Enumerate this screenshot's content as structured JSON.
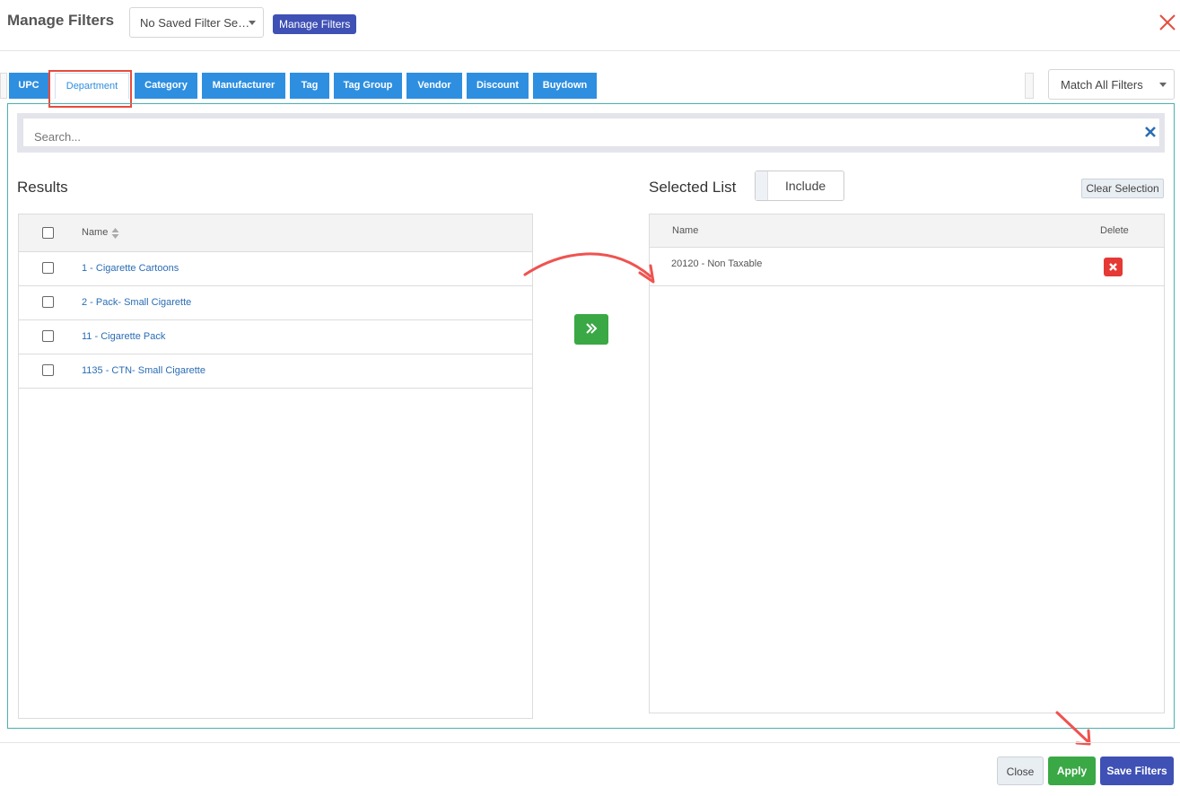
{
  "header": {
    "title": "Manage Filters",
    "saved_filter_value": "No Saved Filter Se…",
    "manage_button": "Manage Filters",
    "close_icon": "close-icon"
  },
  "tabs": [
    {
      "label": "UPC"
    },
    {
      "label": "Department"
    },
    {
      "label": "Category"
    },
    {
      "label": "Manufacturer"
    },
    {
      "label": "Tag"
    },
    {
      "label": "Tag Group"
    },
    {
      "label": "Vendor"
    },
    {
      "label": "Discount"
    },
    {
      "label": "Buydown"
    }
  ],
  "match_select": {
    "value": "Match All Filters"
  },
  "search": {
    "placeholder": "Search..."
  },
  "results": {
    "heading": "Results",
    "column_name": "Name",
    "rows": [
      {
        "label": "1 - Cigarette Cartoons"
      },
      {
        "label": "2 - Pack- Small Cigarette"
      },
      {
        "label": "11 - Cigarette Pack"
      },
      {
        "label": "1135 - CTN- Small Cigarette"
      }
    ]
  },
  "selected": {
    "heading": "Selected List",
    "toggle_label": "Include",
    "clear_button": "Clear Selection",
    "column_name": "Name",
    "column_delete": "Delete",
    "rows": [
      {
        "label": "20120 - Non Taxable"
      }
    ]
  },
  "footer": {
    "close": "Close",
    "apply": "Apply",
    "save": "Save Filters"
  },
  "colors": {
    "tab_blue": "#2e8fe0",
    "primary_indigo": "#3f51b5",
    "success_green": "#3aa845",
    "danger_red": "#e53935",
    "annotation_red": "#e74c3c"
  }
}
